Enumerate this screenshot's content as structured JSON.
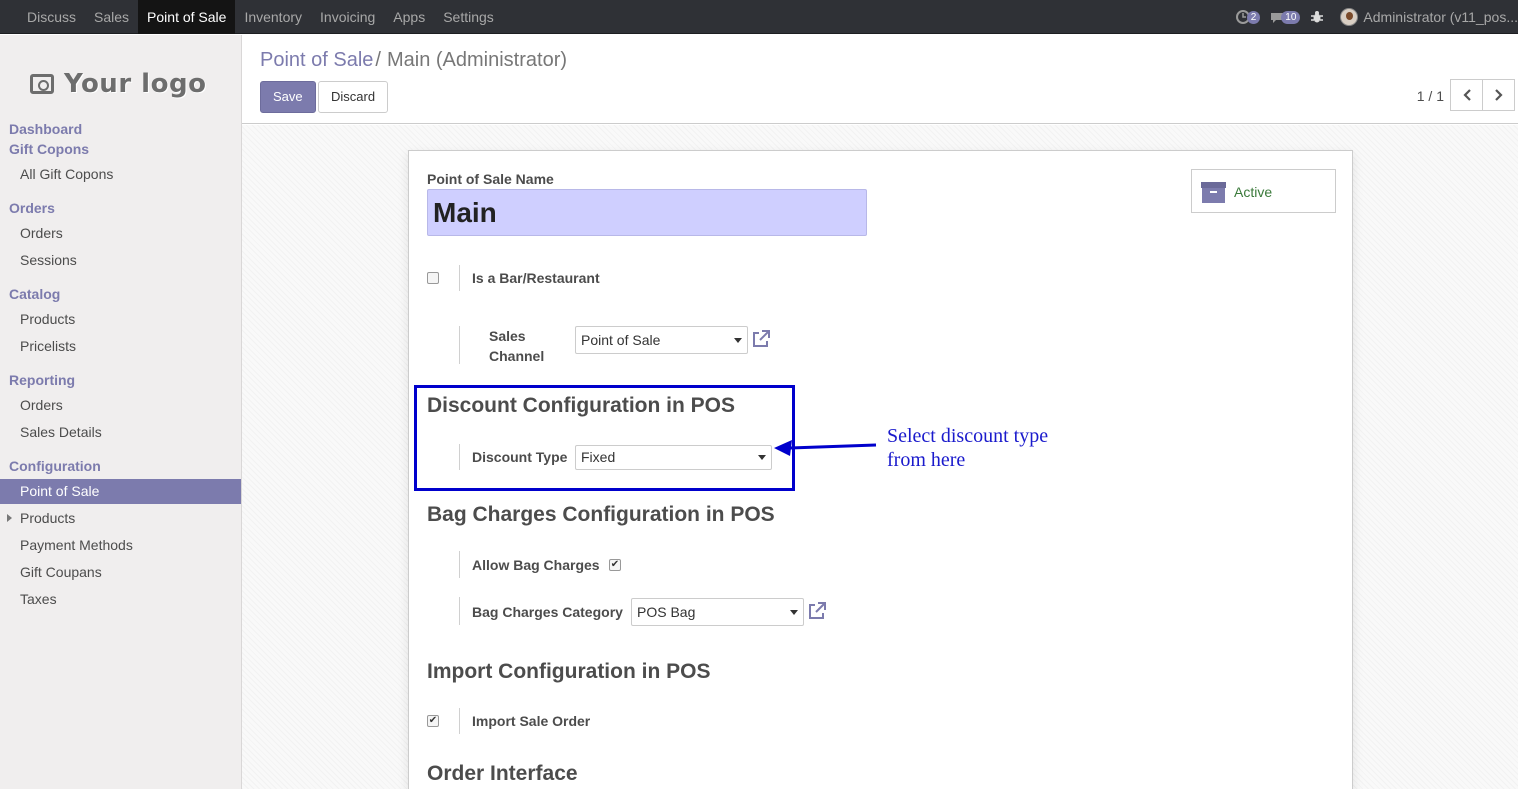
{
  "topbar": {
    "menu": [
      "Discuss",
      "Sales",
      "Point of Sale",
      "Inventory",
      "Invoicing",
      "Apps",
      "Settings"
    ],
    "active_menu": "Point of Sale",
    "activity_count": "2",
    "messages_count": "10",
    "user_name": "Administrator (v11_pos..."
  },
  "sidebar": {
    "logo_text": "Your logo",
    "sections": [
      {
        "title": "Dashboard",
        "items": []
      },
      {
        "title": "Gift Copons",
        "items": [
          "All Gift Copons"
        ]
      },
      {
        "title": "Orders",
        "items": [
          "Orders",
          "Sessions"
        ]
      },
      {
        "title": "Catalog",
        "items": [
          "Products",
          "Pricelists"
        ]
      },
      {
        "title": "Reporting",
        "items": [
          "Orders",
          "Sales Details"
        ]
      },
      {
        "title": "Configuration",
        "items": [
          "Point of Sale",
          "Products",
          "Payment Methods",
          "Gift Coupans",
          "Taxes"
        ]
      }
    ],
    "active_item": "Point of Sale"
  },
  "control_panel": {
    "breadcrumb_parent": "Point of Sale",
    "breadcrumb_separator": "/",
    "breadcrumb_current": "Main (Administrator)",
    "save_label": "Save",
    "discard_label": "Discard",
    "pager": "1 / 1"
  },
  "form": {
    "name_label": "Point of Sale Name",
    "name_value": "Main",
    "active_label": "Active",
    "bar_restaurant_label": "Is a Bar/Restaurant",
    "bar_restaurant_checked": false,
    "sales_channel_label_1": "Sales",
    "sales_channel_label_2": "Channel",
    "sales_channel_value": "Point of Sale",
    "discount_section_title": "Discount Configuration in POS",
    "discount_type_label": "Discount Type",
    "discount_type_value": "Fixed",
    "bag_section_title": "Bag Charges Configuration in POS",
    "allow_bag_label": "Allow Bag Charges",
    "allow_bag_checked": true,
    "bag_category_label": "Bag Charges Category",
    "bag_category_value": "POS Bag",
    "import_section_title": "Import Configuration in POS",
    "import_sale_order_label": "Import Sale Order",
    "import_sale_order_checked": true,
    "order_interface_title": "Order Interface"
  },
  "annotation": {
    "line1": "Select discount type",
    "line2": "from here",
    "color": "#0000cc"
  },
  "colors": {
    "accent": "#7c7bad",
    "navbar": "#2f3136"
  }
}
